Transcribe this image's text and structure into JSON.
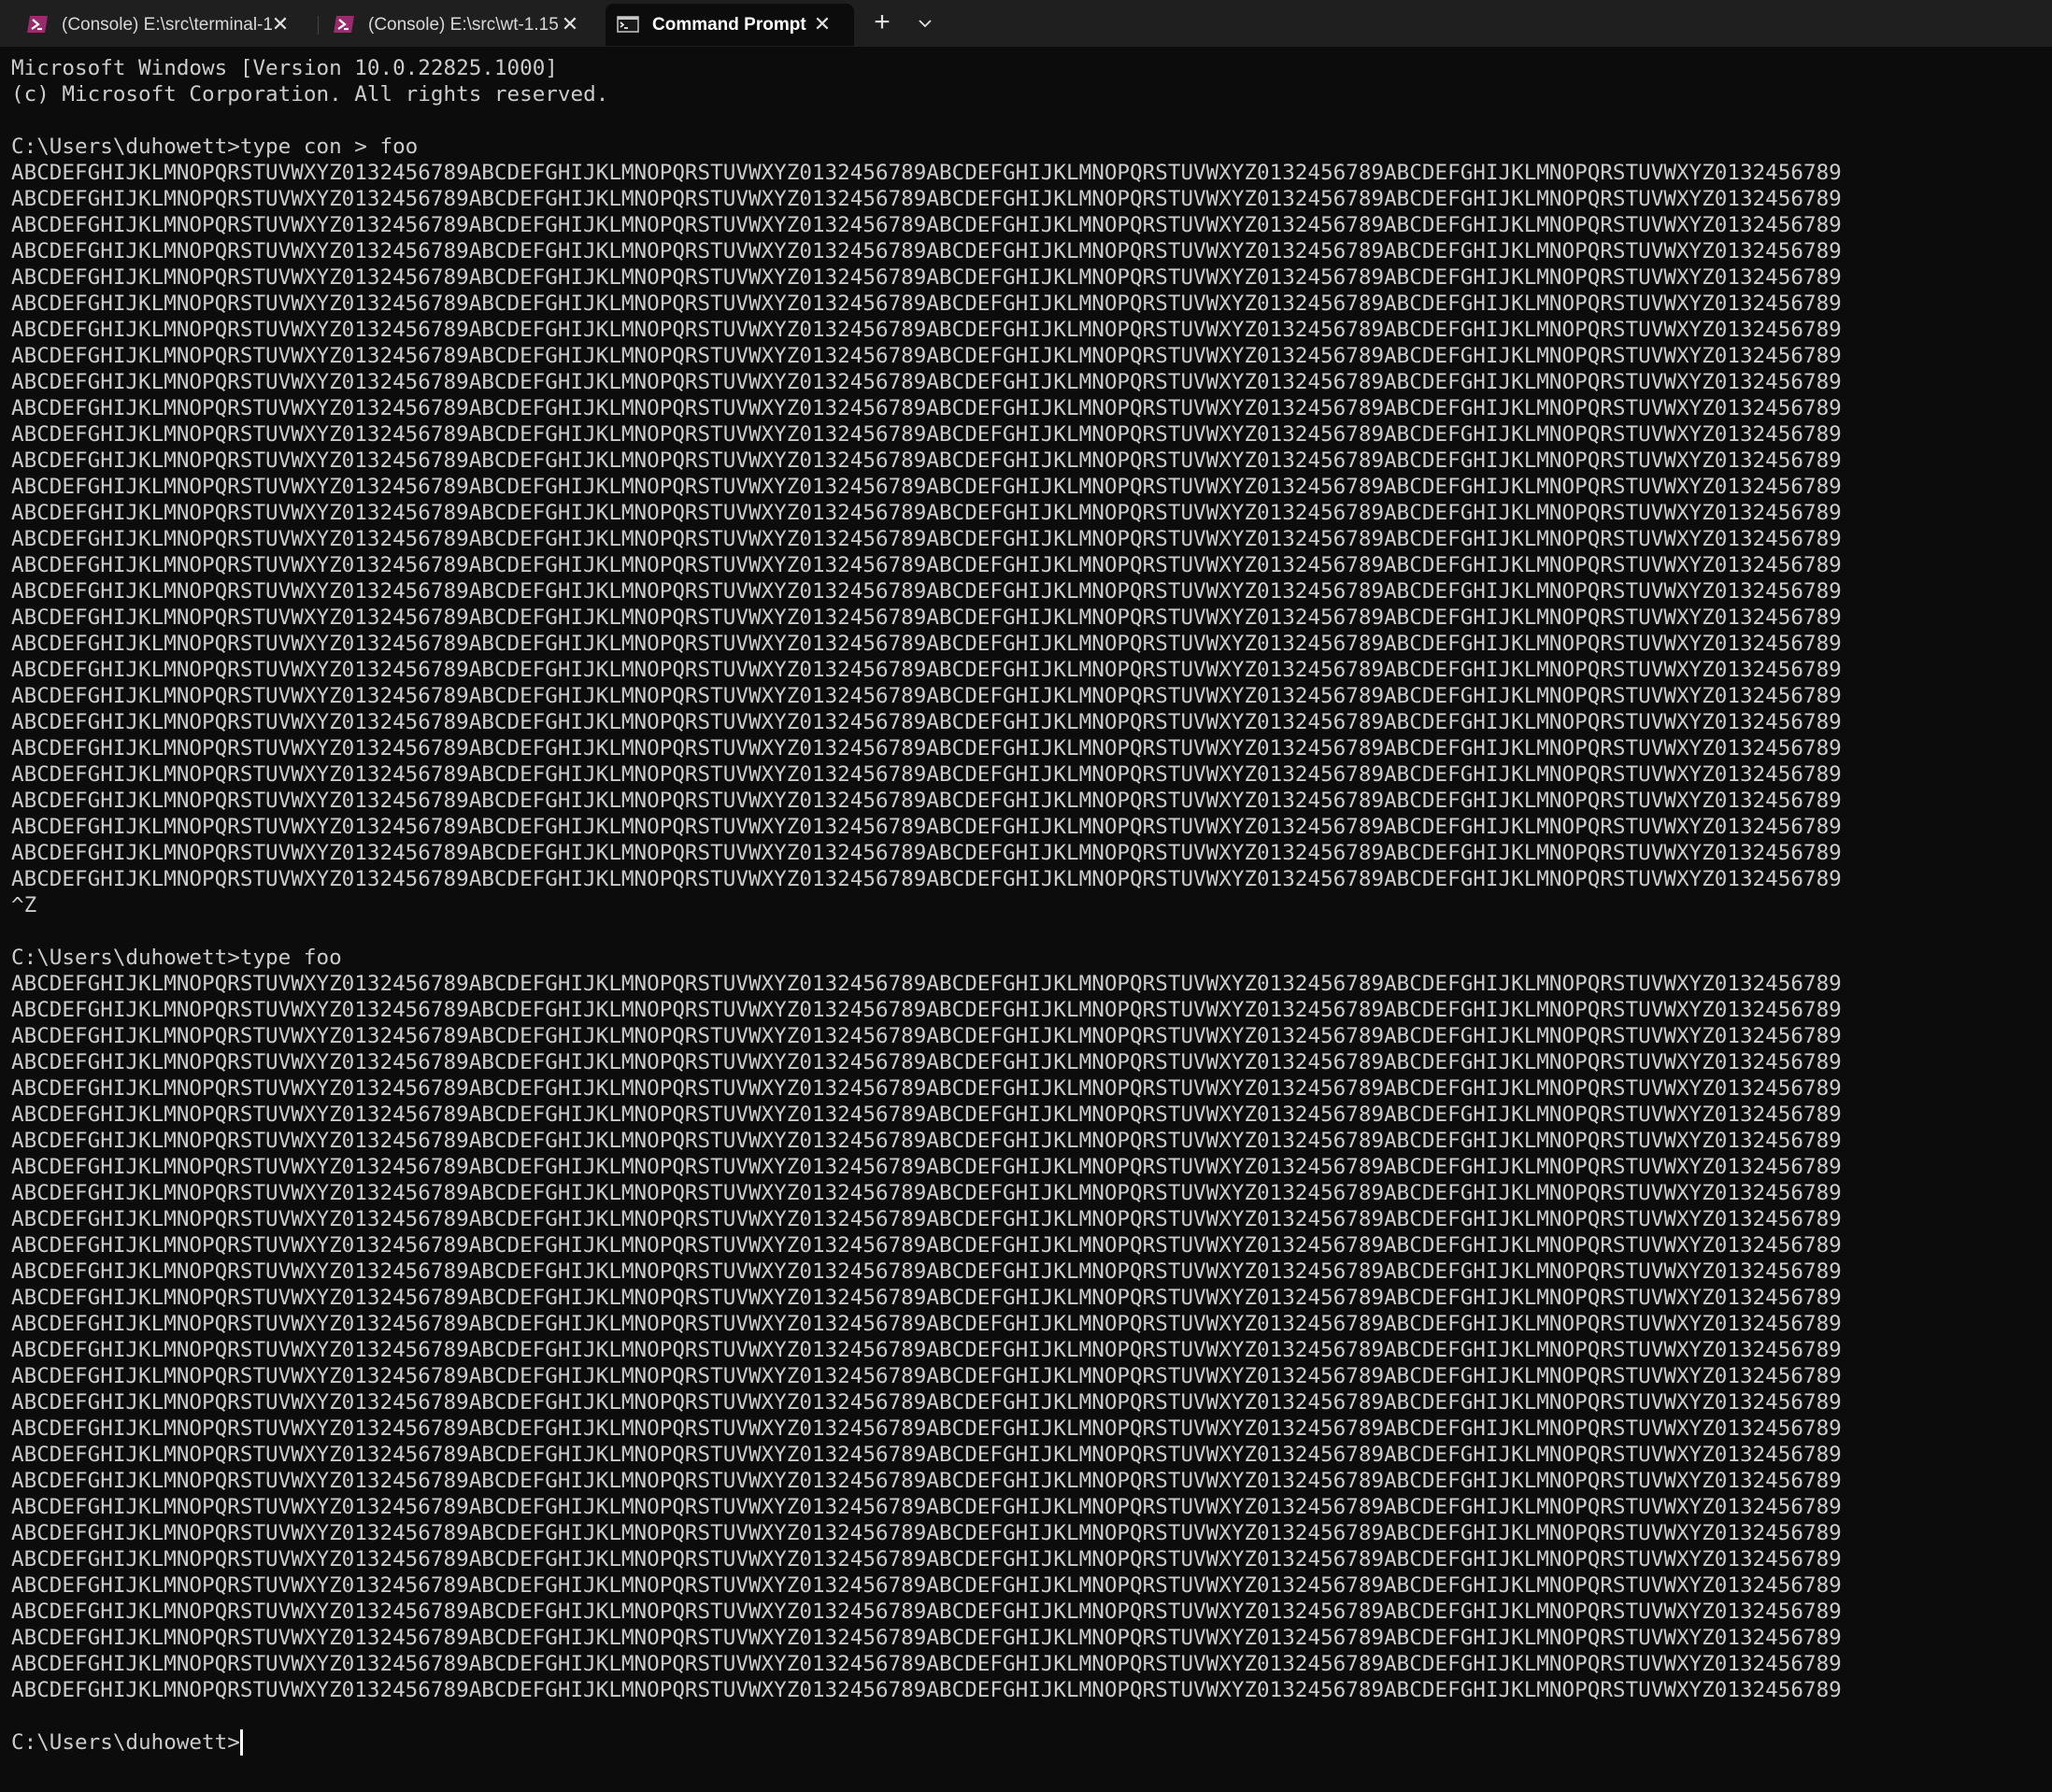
{
  "tabs": [
    {
      "label": "(Console) E:\\src\\terminal-1",
      "icon": "powershell-icon",
      "active": false
    },
    {
      "label": "(Console) E:\\src\\wt-1.15",
      "icon": "powershell-icon",
      "active": false
    },
    {
      "label": "Command Prompt",
      "icon": "cmd-icon",
      "active": true
    }
  ],
  "tab_actions": {
    "new_tab": "+",
    "close_glyph": "✕"
  },
  "colors": {
    "background": "#0c0c0c",
    "tabbar": "#1f1f1f",
    "foreground": "#cccccc",
    "powershell_icon_bg": "#9b2b6e",
    "powershell_icon_fg": "#ffffff"
  },
  "terminal": {
    "header": [
      "Microsoft Windows [Version 10.0.22825.1000]",
      "(c) Microsoft Corporation. All rights reserved.",
      ""
    ],
    "command1": "C:\\Users\\duhowett>type con > foo",
    "input_line": "ABCDEFGHIJKLMNOPQRSTUVWXYZ0132456789ABCDEFGHIJKLMNOPQRSTUVWXYZ0132456789ABCDEFGHIJKLMNOPQRSTUVWXYZ0132456789ABCDEFGHIJKLMNOPQRSTUVWXYZ0132456789",
    "input_line_count": 28,
    "eof_marker": "^Z",
    "command2": "C:\\Users\\duhowett>type foo",
    "output_line": "ABCDEFGHIJKLMNOPQRSTUVWXYZ0132456789ABCDEFGHIJKLMNOPQRSTUVWXYZ0132456789ABCDEFGHIJKLMNOPQRSTUVWXYZ0132456789ABCDEFGHIJKLMNOPQRSTUVWXYZ0132456789",
    "output_line_count": 28,
    "prompt": "C:\\Users\\duhowett>"
  }
}
